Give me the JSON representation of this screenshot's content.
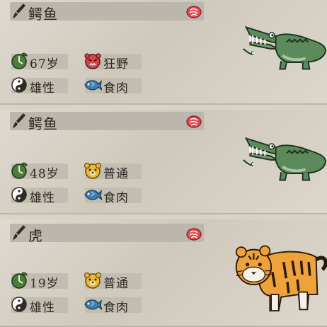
{
  "animals": [
    {
      "name": "鳄鱼",
      "age": "67岁",
      "personality": "狂野",
      "gender": "雄性",
      "diet": "食肉",
      "species_icon": "crocodile-icon",
      "personality_icon": "angry-face-icon"
    },
    {
      "name": "鳄鱼",
      "age": "48岁",
      "personality": "普通",
      "gender": "雄性",
      "diet": "食肉",
      "species_icon": "crocodile-icon",
      "personality_icon": "bear-face-icon"
    },
    {
      "name": "虎",
      "age": "19岁",
      "personality": "普通",
      "gender": "雄性",
      "diet": "食肉",
      "species_icon": "tiger-icon",
      "personality_icon": "bear-face-icon"
    }
  ],
  "colors": {
    "meat_red": "#e8474c",
    "age_green": "#4a7d3c",
    "wild_red": "#d9434a",
    "normal_yellow": "#e9b93a",
    "fish_blue": "#3f7fb0",
    "croc_green": "#5c8a5a",
    "tiger_orange": "#f0a23a"
  }
}
